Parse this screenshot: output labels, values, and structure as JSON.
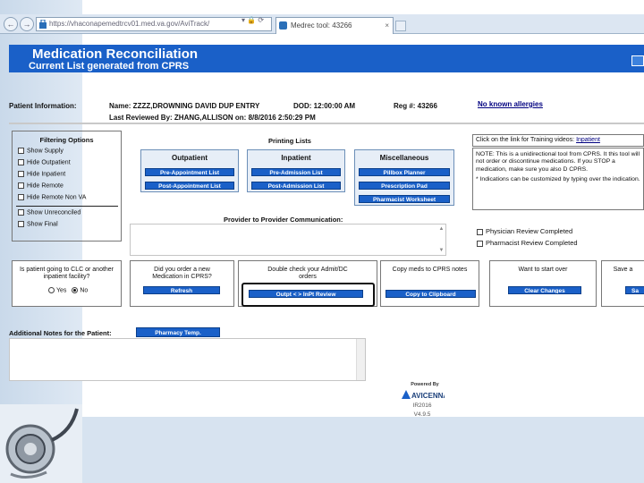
{
  "browser": {
    "url": "https://vhaconapemedtrcv01.med.va.gov/AviTrack/",
    "tab_title": "Medrec tool: 43266",
    "back_glyph": "←",
    "fwd_glyph": "→",
    "url_icons": "▾ 🔒 ⟳",
    "close_glyph": "×"
  },
  "banner": {
    "title": "Medication Reconciliation",
    "subtitle": "Current List generated from CPRS"
  },
  "patient": {
    "info_label": "Patient Information:",
    "name": "Name: ZZZZ,DROWNING DAVID DUP ENTRY",
    "dod": "DOD: 12:00:00 AM",
    "reg": "Reg #: 43266",
    "allergies": "No known allergies",
    "last_reviewed": "Last Reviewed By: ZHANG,ALLISON on: 8/8/2016 2:50:29 PM"
  },
  "filter": {
    "title": "Filtering Options",
    "items": [
      "Show Supply",
      "Hide Outpatient",
      "Hide Inpatient",
      "Hide Remote",
      "Hide Remote Non VA",
      "Show Unreconciled",
      "Show Final"
    ]
  },
  "printing": {
    "title": "Printing Lists",
    "outpatient": {
      "title": "Outpatient",
      "buttons": [
        "Pre-Appointment List",
        "Post-Appointment List"
      ]
    },
    "inpatient": {
      "title": "Inpatient",
      "buttons": [
        "Pre-Admission List",
        "Post-Admission List"
      ]
    },
    "misc": {
      "title": "Miscellaneous",
      "buttons": [
        "Pillbox Planner",
        "Prescription Pad",
        "Pharmacist Worksheet"
      ]
    }
  },
  "provider": {
    "title": "Provider to Provider Communication:",
    "scroll_up": "▲",
    "scroll_down": "▼"
  },
  "notes_right": {
    "line1_pre": "Click on the link for Training videos: ",
    "line1_link": "Inpatient",
    "line2": "NOTE: This is a unidirectional tool from CPRS. It this tool will not order or discontinue medications. If you STOP a medication, make sure you also D CPRS.",
    "line3": "* Indications can be customized by typing over the indication.",
    "physician_review": "Physician Review Completed",
    "pharmacist_review": "Pharmacist Review Completed"
  },
  "actions": {
    "clc_question": "Is patient going to CLC or another inpatient facility?",
    "yes": "Yes",
    "no": "No",
    "new_med_question": "Did you order a new Medication in CPRS?",
    "refresh": "Refresh",
    "double_check": "Double check your Admit/DC orders",
    "review_button": "Outpt < > InPt Review",
    "copy_text": "Copy meds to CPRS notes",
    "copy_button": "Copy to Clipboard",
    "start_over_text": "Want to start over",
    "clear_button": "Clear Changes",
    "save_text": "Save a",
    "save_button": "Sa"
  },
  "notes": {
    "label": "Additional Notes for the Patient:",
    "pharmacy_button": "Pharmacy Temp."
  },
  "footer": {
    "powered_by": "Powered By",
    "logo_text": "AVICENNA",
    "copyright": "IR2016",
    "version": "V4.9.5"
  }
}
